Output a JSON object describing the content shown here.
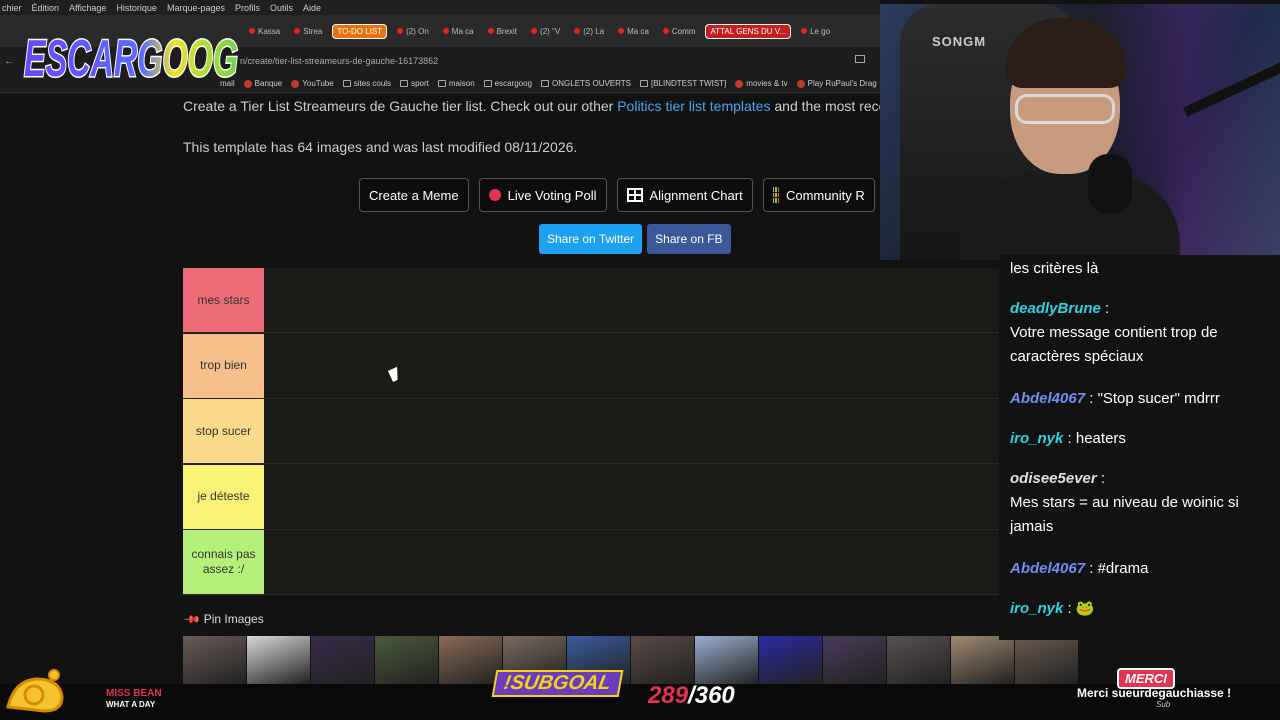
{
  "browser": {
    "menu": [
      "chier",
      "Édition",
      "Affichage",
      "Historique",
      "Marque-pages",
      "Profils",
      "Outils",
      "Aide"
    ],
    "tabs": [
      {
        "label": "Kassa",
        "kind": "plain"
      },
      {
        "label": "Strea",
        "kind": "plain"
      },
      {
        "label": "TO-DO LIST",
        "kind": "orange"
      },
      {
        "label": "(2) On",
        "kind": "plain"
      },
      {
        "label": "Ma ca",
        "kind": "plain"
      },
      {
        "label": "Brexit",
        "kind": "plain"
      },
      {
        "label": "(2) \"V",
        "kind": "plain"
      },
      {
        "label": "(2) La",
        "kind": "plain"
      },
      {
        "label": "Ma ca",
        "kind": "plain"
      },
      {
        "label": "Comm",
        "kind": "plain"
      },
      {
        "label": "ATTAL GENS DU V...",
        "kind": "red"
      },
      {
        "label": "Le go",
        "kind": "plain"
      }
    ],
    "url": "n/create/tier-list-streameurs-de-gauche-16173862",
    "bookmarks": [
      {
        "label": "mail",
        "icon": "none"
      },
      {
        "label": "Banque",
        "icon": "round"
      },
      {
        "label": "YouTube",
        "icon": "round"
      },
      {
        "label": "sites couls",
        "icon": "folder"
      },
      {
        "label": "sport",
        "icon": "folder"
      },
      {
        "label": "maison",
        "icon": "folder"
      },
      {
        "label": "escargoog",
        "icon": "folder"
      },
      {
        "label": "ONGLETS OUVERTS",
        "icon": "folder"
      },
      {
        "label": "[BLINDTEST TWIST]",
        "icon": "folder"
      },
      {
        "label": "movies & tv",
        "icon": "round"
      },
      {
        "label": "Play RuPaul's Drag",
        "icon": "round"
      }
    ]
  },
  "overlay": {
    "logo_text": "ESCARGOOG"
  },
  "page": {
    "intro_before": "Create a Tier List Streameurs de Gauche tier list. Check out our other ",
    "intro_link": "Politics tier list templates",
    "intro_after": " and the most recen",
    "meta": "This template has 64 images and was last modified 08/11/2026.",
    "buttons": {
      "meme": "Create a Meme",
      "poll": "Live Voting Poll",
      "alignment": "Alignment Chart",
      "community": "Community R"
    },
    "share": {
      "twitter": "Share on Twitter",
      "facebook": "Share on FB"
    },
    "tiers": [
      {
        "label": "mes stars",
        "color": "#ee6b78"
      },
      {
        "label": "trop bien",
        "color": "#f7c08a"
      },
      {
        "label": "stop sucer",
        "color": "#fad98a"
      },
      {
        "label": "je déteste",
        "color": "#f9f277"
      },
      {
        "label": "connais pas assez :/",
        "color": "#b4f07a"
      }
    ],
    "pin_label": "Pin Images"
  },
  "webcam": {
    "chair_brand": "SONGM"
  },
  "chat": {
    "messages": [
      {
        "user": "",
        "text": "les critères là",
        "color": "#ffffff"
      },
      {
        "user": "deadlyBrune",
        "text": "Votre message contient trop de caractères spéciaux",
        "color": "#2fd3e0"
      },
      {
        "user": "Abdel4067",
        "text": "\"Stop sucer\" mdrrr",
        "color": "#6f8ef0"
      },
      {
        "user": "iro_nyk",
        "text": "heaters",
        "color": "#2fd3e0"
      },
      {
        "user": "odisee5ever",
        "text": "Mes stars = au niveau de woinic si jamais",
        "color": "#e0e0e0"
      },
      {
        "user": "Abdel4067",
        "text": "#drama",
        "color": "#6f8ef0"
      },
      {
        "user": "iro_nyk",
        "text": "🐸",
        "color": "#2fd3e0"
      }
    ]
  },
  "bottom": {
    "miss_bean": "MISS BEAN",
    "miss_bean_sub": "WHAT A DAY",
    "subgoal": "!SUBGOAL",
    "sub_current": "289",
    "sub_total": "/360",
    "merci_badge": "MERCI",
    "merci_text": "Merci sueurdegauchiasse !",
    "merci_sub": "Sub"
  }
}
